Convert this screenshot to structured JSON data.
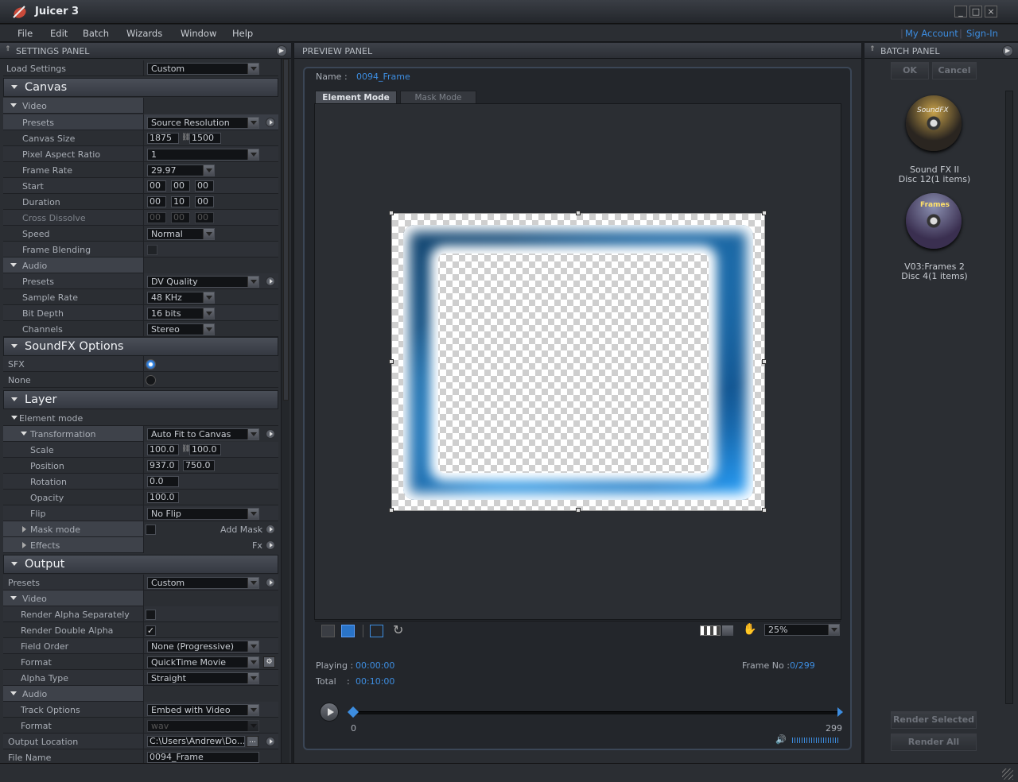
{
  "window": {
    "title": "Juicer 3",
    "minimize": "_",
    "maximize": "□",
    "close": "×"
  },
  "menu": [
    "File",
    "Edit",
    "Batch",
    "Wizards",
    "Window",
    "Help"
  ],
  "account": {
    "my_account": "My Account",
    "separator": "|",
    "sign_in": "Sign-In"
  },
  "settings": {
    "header": "SETTINGS PANEL",
    "load_settings": {
      "label": "Load Settings",
      "value": "Custom"
    },
    "canvas": {
      "title": "Canvas",
      "video": {
        "title": "Video",
        "presets": {
          "label": "Presets",
          "value": "Source Resolution"
        },
        "canvas_size": {
          "label": "Canvas Size",
          "w": "1875",
          "h": "1500"
        },
        "pixel_aspect": {
          "label": "Pixel Aspect Ratio",
          "value": "1"
        },
        "frame_rate": {
          "label": "Frame Rate",
          "value": "29.97"
        },
        "start": {
          "label": "Start",
          "a": "00",
          "b": "00",
          "c": "00"
        },
        "duration": {
          "label": "Duration",
          "a": "00",
          "b": "10",
          "c": "00"
        },
        "cross_dissolve": {
          "label": "Cross Dissolve",
          "a": "00",
          "b": "00",
          "c": "00"
        },
        "speed": {
          "label": "Speed",
          "value": "Normal"
        },
        "frame_blending": {
          "label": "Frame Blending"
        }
      },
      "audio": {
        "title": "Audio",
        "presets": {
          "label": "Presets",
          "value": "DV Quality"
        },
        "sample_rate": {
          "label": "Sample Rate",
          "value": "48 KHz"
        },
        "bit_depth": {
          "label": "Bit Depth",
          "value": "16 bits"
        },
        "channels": {
          "label": "Channels",
          "value": "Stereo"
        }
      }
    },
    "soundfx": {
      "title": "SoundFX Options",
      "sfx": "SFX",
      "none": "None"
    },
    "layer": {
      "title": "Layer",
      "element_mode": "Element mode",
      "transformation": {
        "label": "Transformation",
        "value": "Auto Fit to Canvas"
      },
      "scale": {
        "label": "Scale",
        "x": "100.0",
        "y": "100.0"
      },
      "position": {
        "label": "Position",
        "x": "937.0",
        "y": "750.0"
      },
      "rotation": {
        "label": "Rotation",
        "value": "0.0"
      },
      "opacity": {
        "label": "Opacity",
        "value": "100.0"
      },
      "flip": {
        "label": "Flip",
        "value": "No Flip"
      },
      "mask_mode": {
        "label": "Mask mode",
        "action": "Add Mask"
      },
      "effects": {
        "label": "Effects",
        "action": "Fx"
      }
    },
    "output": {
      "title": "Output",
      "presets": {
        "label": "Presets",
        "value": "Custom"
      },
      "video": {
        "title": "Video",
        "render_alpha_separately": {
          "label": "Render Alpha Separately",
          "checked": false
        },
        "render_double_alpha": {
          "label": "Render Double Alpha",
          "checked": true,
          "mark": "✓"
        },
        "field_order": {
          "label": "Field Order",
          "value": "None (Progressive)"
        },
        "format": {
          "label": "Format",
          "value": "QuickTime Movie"
        },
        "alpha_type": {
          "label": "Alpha Type",
          "value": "Straight"
        }
      },
      "audio": {
        "title": "Audio",
        "track_options": {
          "label": "Track Options",
          "value": "Embed with Video"
        },
        "format": {
          "label": "Format",
          "value": "wav"
        }
      },
      "output_location": {
        "label": "Output Location",
        "value": "C:\\Users\\Andrew\\Do...",
        "browse": "..."
      },
      "file_name": {
        "label": "File Name",
        "value": "0094_Frame"
      }
    }
  },
  "preview": {
    "header": "PREVIEW PANEL",
    "name_label": "Name :",
    "name_value": "0094_Frame",
    "tabs": [
      "Element Mode",
      "Mask Mode"
    ],
    "zoom": "25%",
    "playing_label": "Playing :",
    "playing_value": "00:00:00",
    "total_label": "Total",
    "total_sep": ":",
    "total_value": "00:10:00",
    "frame_label": "Frame No :",
    "frame_value": "0/299",
    "timeline_start": "0",
    "timeline_end": "299",
    "timeline_progress": 0
  },
  "batch": {
    "header": "BATCH PANEL",
    "ok": "OK",
    "cancel": "Cancel",
    "items": [
      {
        "line1": "Sound FX II",
        "line2": "Disc 12(1 items)",
        "disc_label": "SoundFX"
      },
      {
        "line1": "V03:Frames 2",
        "line2": "Disc 4(1 items)",
        "disc_label": "Frames"
      }
    ],
    "render_selected": "Render Selected",
    "render_all": "Render All"
  },
  "colors": {
    "accent": "#3d8de0",
    "panel": "#2b2e33",
    "background": "#1b1d21"
  }
}
